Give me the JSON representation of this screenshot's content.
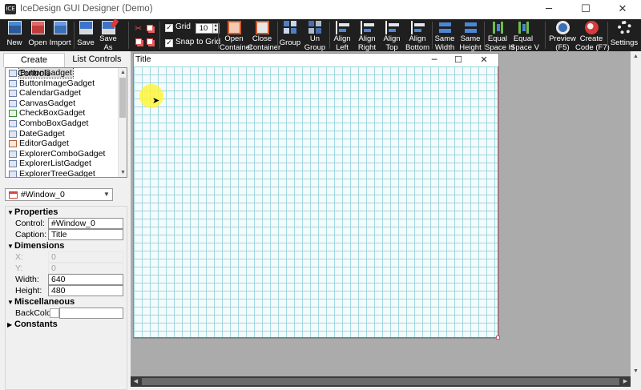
{
  "window": {
    "title": "IceDesign GUI Designer (Demo)",
    "app_icon_text": "ICE",
    "minimize_glyph": "─",
    "maximize_glyph": "☐",
    "close_glyph": "✕"
  },
  "toolbar": {
    "new": "New",
    "open": "Open",
    "import": "Import",
    "save": "Save",
    "save_as_1": "Save",
    "save_as_2": "As",
    "cut_glyph": "✂",
    "grid_label": "Grid",
    "grid_value": "10",
    "grid_checked": "✓",
    "snap_label": "Snap to Grid",
    "snap_checked": "✓",
    "open_container_1": "Open",
    "open_container_2": "Container",
    "close_container_1": "Close",
    "close_container_2": "Container",
    "group": "Group",
    "ungroup_1": "Un",
    "ungroup_2": "Group",
    "align_left_1": "Align",
    "align_left_2": "Left",
    "align_right_1": "Align",
    "align_right_2": "Right",
    "align_top_1": "Align",
    "align_top_2": "Top",
    "align_bottom_1": "Align",
    "align_bottom_2": "Bottom",
    "same_width_1": "Same",
    "same_width_2": "Width",
    "same_height_1": "Same",
    "same_height_2": "Height",
    "equal_h_1": "Equal",
    "equal_h_2": "Space H",
    "equal_v_1": "Equal",
    "equal_v_2": "Space V",
    "preview_1": "Preview",
    "preview_2": "(F5)",
    "create_code_1": "Create",
    "create_code_2": "Code (F7)",
    "settings": "Settings"
  },
  "left_panel": {
    "tabs": [
      "Create Controls",
      "List Controls"
    ],
    "controls": [
      "ButtonGadget",
      "ButtonImageGadget",
      "CalendarGadget",
      "CanvasGadget",
      "CheckBoxGadget",
      "ComboBoxGadget",
      "DateGadget",
      "EditorGadget",
      "ExplorerComboGadget",
      "ExplorerListGadget",
      "ExplorerTreeGadget"
    ],
    "selected_object": "#Window_0",
    "properties": {
      "section": "Properties",
      "control_label": "Control:",
      "control_value": "#Window_0",
      "caption_label": "Caption:",
      "caption_value": "Title"
    },
    "dimensions": {
      "section": "Dimensions",
      "x_label": "X:",
      "x_value": "0",
      "y_label": "Y:",
      "y_value": "0",
      "width_label": "Width:",
      "width_value": "640",
      "height_label": "Height:",
      "height_value": "480"
    },
    "misc": {
      "section": "Miscellaneous",
      "backcolor_label": "BackColor:"
    },
    "constants": {
      "section": "Constants"
    },
    "expanded_glyph": "▼",
    "collapsed_glyph": "▶"
  },
  "design": {
    "form_title": "Title",
    "minimize_glyph": "─",
    "maximize_glyph": "☐",
    "close_glyph": "✕",
    "grid_line_color": "#9fd7df",
    "canvas_background": "#ababab"
  }
}
